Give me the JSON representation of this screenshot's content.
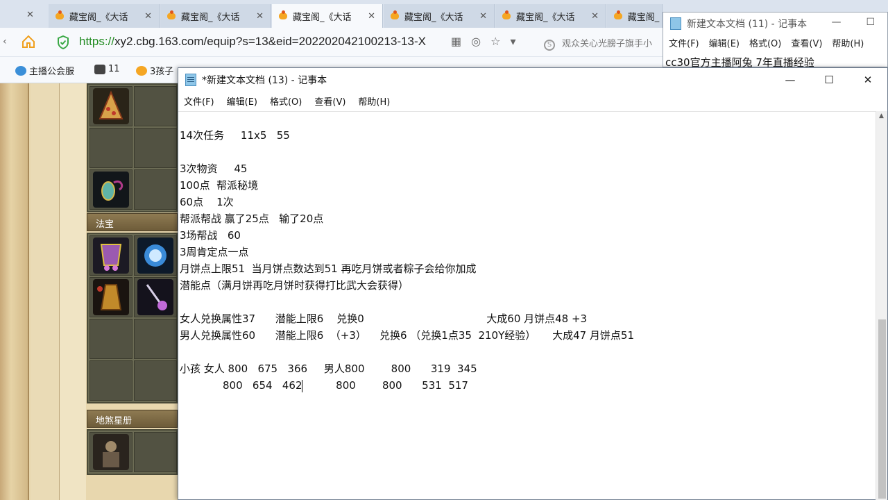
{
  "browser": {
    "tabs": [
      {
        "label": "藏宝阁_《大话"
      },
      {
        "label": "藏宝阁_《大话"
      },
      {
        "label": "藏宝阁_《大话"
      },
      {
        "label": "藏宝阁_《大话"
      },
      {
        "label": "藏宝阁_《大话"
      },
      {
        "label": "藏宝阁_《大话"
      }
    ],
    "tab_close": "✕",
    "url_proto": "https://",
    "url_rest": "xy2.cbg.163.com/equip?s=13&eid=202202042100213-13-X",
    "search_hint": "观众关心光膀子旗手小",
    "bookmarks": [
      {
        "label": "主播公会服",
        "color": "#3b8fd8"
      },
      {
        "label": "11",
        "color": "#444444"
      },
      {
        "label": "3孩子",
        "color": "#f5a623"
      }
    ],
    "tray_text": "☐ ☐ ☐"
  },
  "game_page": {
    "section_fabao": "法宝",
    "section_disha": "地煞星册"
  },
  "bg_notepad": {
    "title": "新建文本文档 (11) - 记事本",
    "menu": [
      "文件(F)",
      "编辑(E)",
      "格式(O)",
      "查看(V)",
      "帮助(H)"
    ],
    "first_line": "cc30官方主播阿兔 7年直播经验",
    "min": "—",
    "max": "☐"
  },
  "notepad": {
    "title": "*新建文本文档 (13) - 记事本",
    "menu": {
      "file": "文件(F)",
      "edit": "编辑(E)",
      "format": "格式(O)",
      "view": "查看(V)",
      "help": "帮助(H)"
    },
    "controls": {
      "min": "—",
      "max": "☐",
      "close": "✕"
    },
    "lines": [
      "14次任务     11x5   55",
      "",
      "3次物资     45",
      "100点  帮派秘境",
      "60点    1次",
      "帮派帮战 赢了25点   输了20点",
      "3场帮战   60",
      "3周肯定点一点",
      "月饼点上限51  当月饼点数达到51 再吃月饼或者粽子会给你加成",
      "潜能点（满月饼再吃月饼时获得打比武大会获得）",
      "",
      "女人兑换属性37      潜能上限6    兑换0                                     大成60 月饼点48 +3",
      "男人兑换属性60      潜能上限6  （+3）    兑换6 （兑换1点35  210Y经验）     大成47 月饼点51",
      "",
      "小孩 女人 800   675   366     男人800        800      319  345",
      "             800   654   462"
    ],
    "last_line_tail": "          800        800      531  517"
  }
}
